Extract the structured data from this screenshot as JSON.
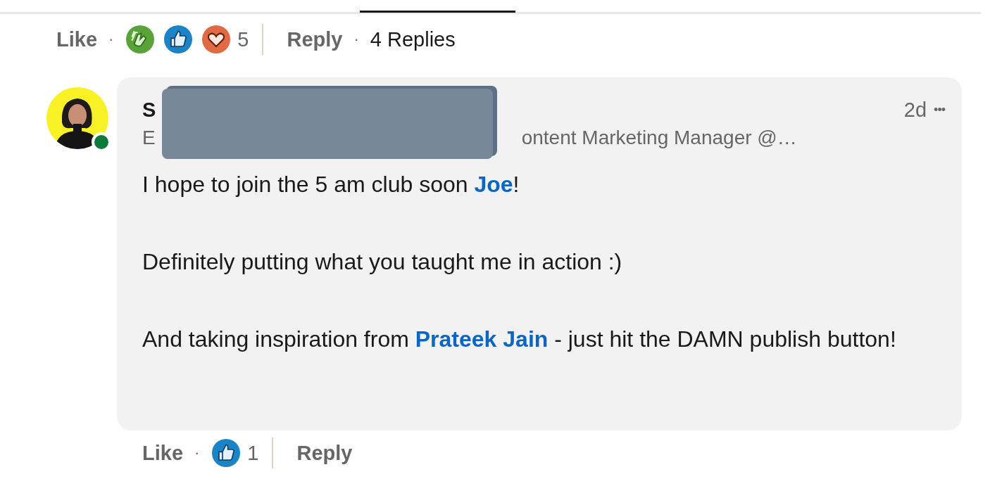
{
  "parent_actions": {
    "like": "Like",
    "separator": "·",
    "reactions": [
      {
        "kind": "celebrate"
      },
      {
        "kind": "like"
      },
      {
        "kind": "love"
      }
    ],
    "reaction_count": "5",
    "reply": "Reply",
    "separator_2": "·",
    "replies": "4 Replies"
  },
  "comment": {
    "author_initial": "S",
    "headline_start": "E",
    "headline_end": "ontent Marketing Manager @…",
    "online": true,
    "redacted": true,
    "time": "2d",
    "more": "•••",
    "paragraphs": [
      [
        {
          "text": "I hope to join the 5 am club soon "
        },
        {
          "text": "Joe",
          "kind": "mention"
        },
        {
          "text": "!"
        }
      ],
      [
        {
          "text": "Definitely putting what you taught me in action :)"
        }
      ],
      [
        {
          "text": "And taking inspiration from "
        },
        {
          "text": "Prateek Jain",
          "kind": "mention"
        },
        {
          "text": " - just hit the DAMN publish button!"
        }
      ]
    ],
    "actions": {
      "like": "Like",
      "separator": "·",
      "reactions": [
        {
          "kind": "like"
        }
      ],
      "reaction_count": "1",
      "reply": "Reply"
    }
  }
}
